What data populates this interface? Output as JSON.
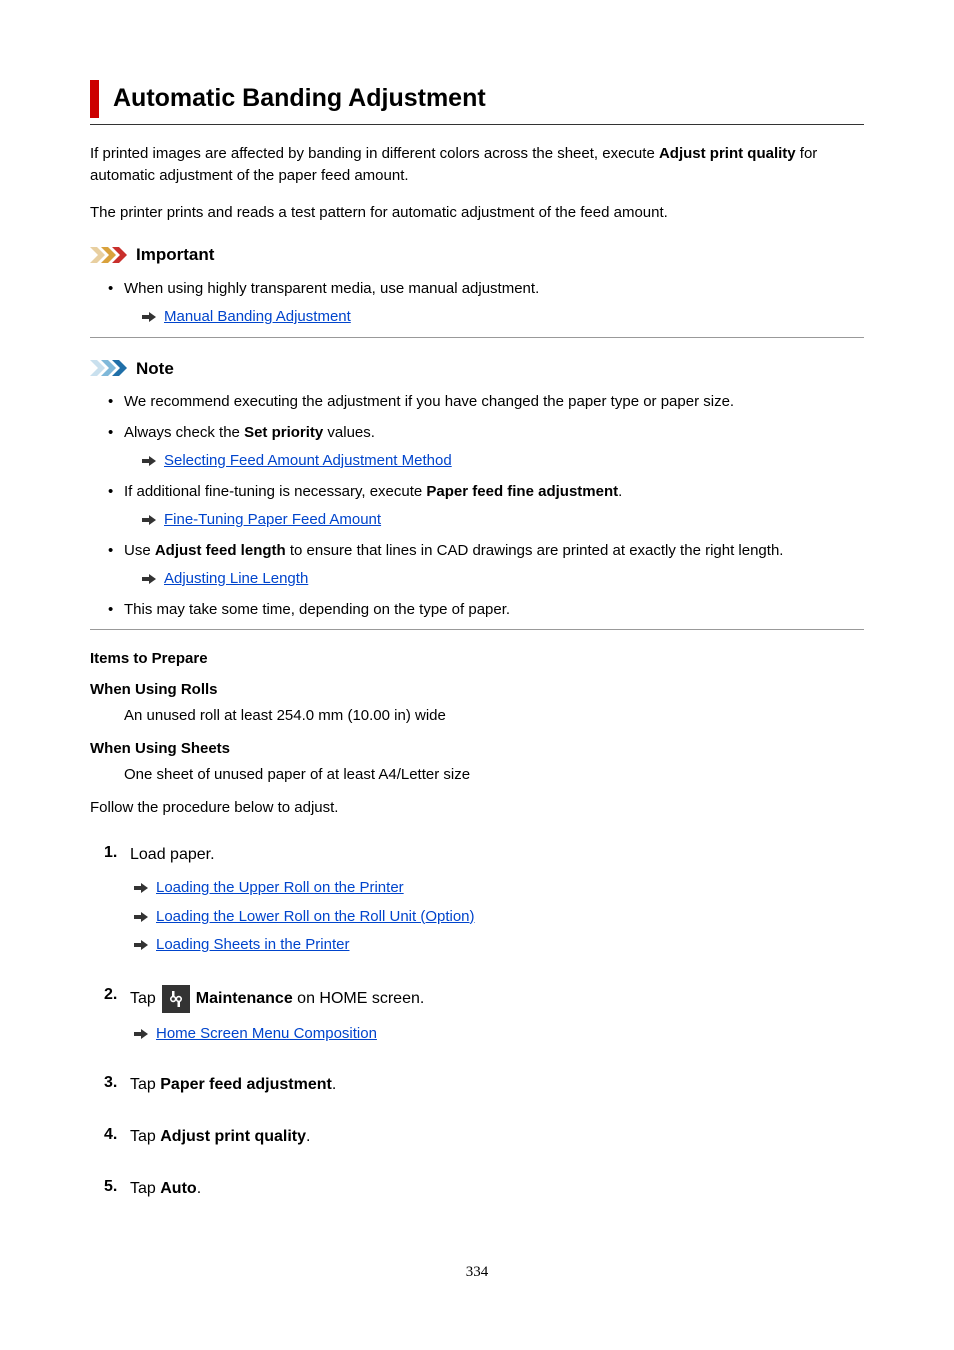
{
  "title": "Automatic Banding Adjustment",
  "intro": {
    "p1_a": "If printed images are affected by banding in different colors across the sheet, execute ",
    "p1_bold": "Adjust print quality",
    "p1_b": " for automatic adjustment of the paper feed amount.",
    "p2": "The printer prints and reads a test pattern for automatic adjustment of the feed amount."
  },
  "important": {
    "label": "Important",
    "item1": "When using highly transparent media, use manual adjustment.",
    "link1": "Manual Banding Adjustment"
  },
  "note": {
    "label": "Note",
    "item1": "We recommend executing the adjustment if you have changed the paper type or paper size.",
    "item2_a": "Always check the ",
    "item2_bold": "Set priority",
    "item2_b": " values.",
    "link2": "Selecting Feed Amount Adjustment Method",
    "item3_a": "If additional fine-tuning is necessary, execute ",
    "item3_bold": "Paper feed fine adjustment",
    "item3_b": ".",
    "link3": "Fine-Tuning Paper Feed Amount",
    "item4_a": "Use ",
    "item4_bold": "Adjust feed length",
    "item4_b": " to ensure that lines in CAD drawings are printed at exactly the right length.",
    "link4": "Adjusting Line Length",
    "item5": "This may take some time, depending on the type of paper."
  },
  "prepare": {
    "heading": "Items to Prepare",
    "rolls_heading": "When Using Rolls",
    "rolls_text": "An unused roll at least 254.0 mm (10.00 in) wide",
    "sheets_heading": "When Using Sheets",
    "sheets_text": "One sheet of unused paper of at least A4/Letter size",
    "follow": "Follow the procedure below to adjust."
  },
  "steps": {
    "s1": {
      "num": "1.",
      "text": "Load paper.",
      "links": {
        "a": "Loading the Upper Roll on the Printer",
        "b": "Loading the Lower Roll on the Roll Unit (Option)",
        "c": "Loading Sheets in the Printer"
      }
    },
    "s2": {
      "num": "2.",
      "pre": "Tap ",
      "bold": "Maintenance",
      "post": " on HOME screen.",
      "link": "Home Screen Menu Composition"
    },
    "s3": {
      "num": "3.",
      "pre": "Tap ",
      "bold": "Paper feed adjustment",
      "post": "."
    },
    "s4": {
      "num": "4.",
      "pre": "Tap ",
      "bold": "Adjust print quality",
      "post": "."
    },
    "s5": {
      "num": "5.",
      "pre": "Tap ",
      "bold": "Auto",
      "post": "."
    }
  },
  "page_number": "334"
}
